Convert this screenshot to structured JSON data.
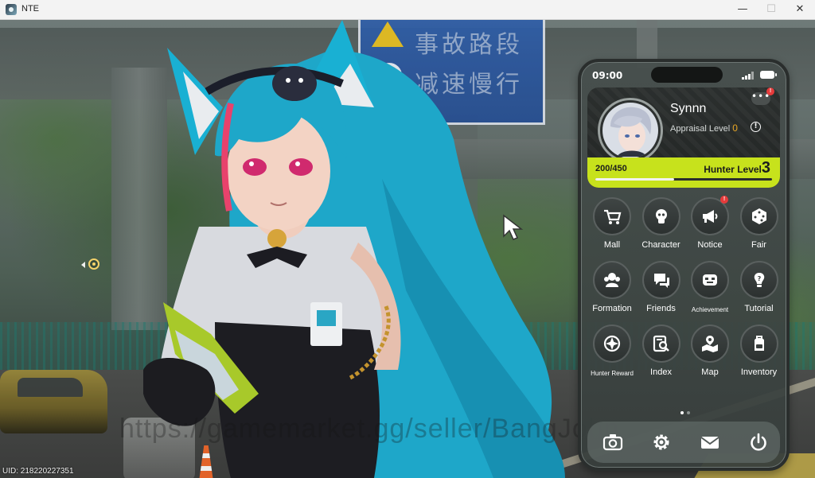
{
  "window": {
    "title": "NTE",
    "minimize": "—",
    "maximize": "☐",
    "close": "✕"
  },
  "scene": {
    "sign_line1": "事故路段",
    "sign_line2": "减速慢行",
    "uid": "UID:  218220227351",
    "watermark": "https://gamemarket.gg/seller/BangJohn"
  },
  "phone": {
    "time": "09:00",
    "profile": {
      "more_label": "•••",
      "more_badge": "!",
      "username": "Synnn",
      "appraisal_label": "Appraisal Level",
      "appraisal_level": "0",
      "info_label": "!",
      "xp_text": "200/450",
      "xp_progress": 0.444,
      "hunter_label": "Hunter Level",
      "hunter_level": "3"
    },
    "apps": [
      {
        "label": "Mall",
        "icon": "cart-icon"
      },
      {
        "label": "Character",
        "icon": "character-icon"
      },
      {
        "label": "Notice",
        "icon": "megaphone-icon",
        "badge": "!"
      },
      {
        "label": "Fair",
        "icon": "dice-icon"
      },
      {
        "label": "Formation",
        "icon": "formation-icon"
      },
      {
        "label": "Friends",
        "icon": "chat-bubbles-icon"
      },
      {
        "label": "Achievement",
        "icon": "achievement-icon"
      },
      {
        "label": "Tutorial",
        "icon": "lightbulb-icon"
      },
      {
        "label": "Hunter Reward",
        "icon": "compass-icon"
      },
      {
        "label": "Index",
        "icon": "book-search-icon"
      },
      {
        "label": "Map",
        "icon": "map-pin-icon"
      },
      {
        "label": "Inventory",
        "icon": "backpack-icon"
      }
    ],
    "page_indicator": {
      "pages": 2,
      "active": 1
    },
    "dock": [
      "camera-icon",
      "settings-gear-icon",
      "mail-icon",
      "power-icon"
    ]
  },
  "colors": {
    "accent_lime": "#c7e21c",
    "badge_red": "#e63b3b",
    "appraisal_gold": "#e8a623"
  }
}
